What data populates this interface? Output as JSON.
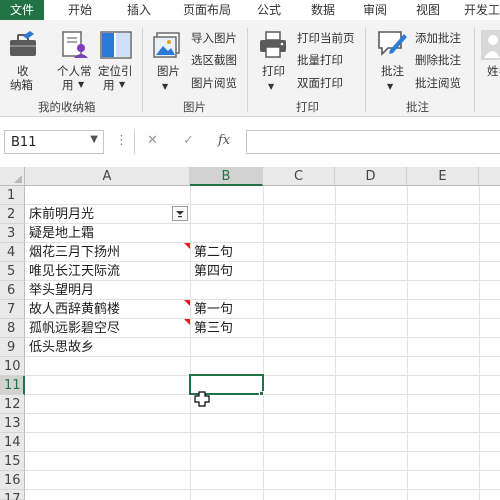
{
  "tabs": [
    {
      "label": "文件",
      "active": true
    },
    {
      "label": "开始",
      "active": false
    },
    {
      "label": "插入",
      "active": false
    },
    {
      "label": "页面布局",
      "active": false
    },
    {
      "label": "公式",
      "active": false
    },
    {
      "label": "数据",
      "active": false
    },
    {
      "label": "审阅",
      "active": false
    },
    {
      "label": "视图",
      "active": false
    },
    {
      "label": "开发工",
      "active": false
    }
  ],
  "ribbon": {
    "group_collection": {
      "title": "我的收纳箱",
      "collect_line1": "收",
      "collect_line2": "纳箱",
      "personal_line1": "个人常",
      "personal_line2": "用",
      "locate_line1": "定位引",
      "locate_line2": "用"
    },
    "group_picture": {
      "title": "图片",
      "picture_label": "图片",
      "import_picture": "导入图片",
      "region_screenshot": "选区截图",
      "picture_browse": "图片阅览"
    },
    "group_print": {
      "title": "打印",
      "print_label": "打印",
      "print_current_page": "打印当前页",
      "batch_print": "批量打印",
      "duplex_print": "双面打印"
    },
    "group_comment": {
      "title": "批注",
      "comment_label": "批注",
      "add_comment": "添加批注",
      "delete_comment": "删除批注",
      "comment_browse": "批注阅览"
    },
    "partial_label": "姓名"
  },
  "formula_bar": {
    "name_box": "B11",
    "cancel_symbol": "✕",
    "enter_symbol": "✓",
    "fx_symbol": "fx",
    "more_symbol": "⋮",
    "formula": ""
  },
  "sheet": {
    "columns": [
      "A",
      "B",
      "C",
      "D",
      "E"
    ],
    "selected_column": "B",
    "rows": [
      "1",
      "2",
      "3",
      "4",
      "5",
      "6",
      "7",
      "8",
      "9",
      "10",
      "11",
      "12",
      "13",
      "14",
      "15",
      "16",
      "17"
    ],
    "selected_row": "11",
    "cells": {
      "A2": "床前明月光",
      "A3": "疑是地上霜",
      "A4": "烟花三月下扬州",
      "A5": "唯见长江天际流",
      "A6": "举头望明月",
      "A7": "故人西辞黄鹤楼",
      "A8": "孤帆远影碧空尽",
      "A9": "低头思故乡",
      "B4": "第二句",
      "B5": "第四句",
      "B7": "第一句",
      "B8": "第三句"
    },
    "active_cell": "B11",
    "filter_cell": "A2",
    "comment_cells": [
      "A4",
      "A7",
      "A8"
    ]
  },
  "colors": {
    "accent": "#217346",
    "comment_marker": "#e21d1d"
  }
}
